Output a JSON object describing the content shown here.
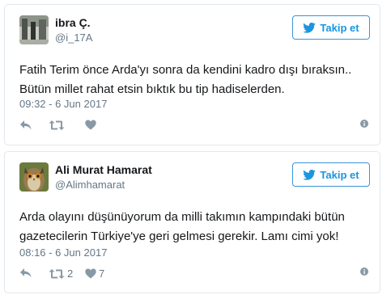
{
  "tweets": [
    {
      "name": "ibra Ç.",
      "handle": "@i_17A",
      "follow_label": "Takip et",
      "text": "Fatih Terim önce Arda'yı sonra da kendini kadro dışı bıraksın.. Bütün millet rahat etsin bıktık bu tip hadiselerden.",
      "time": "09:32 - 6 Jun 2017",
      "retweet_count": "",
      "like_count": ""
    },
    {
      "name": "Ali Murat Hamarat",
      "handle": "@Alimhamarat",
      "follow_label": "Takip et",
      "text": "Arda olayını düşünüyorum da milli takımın kampındaki bütün gazetecilerin Türkiye'ye geri gelmesi gerekir. Lamı cimi yok!",
      "time": "08:16 - 6 Jun 2017",
      "retweet_count": "2",
      "like_count": "7"
    }
  ],
  "colors": {
    "twitter_blue": "#1b95e0",
    "icon_gray": "#8899a6",
    "meta_gray": "#657786",
    "border": "#e1e8ed"
  },
  "icons": [
    "twitter-bird-icon",
    "reply-icon",
    "retweet-icon",
    "heart-icon",
    "info-icon"
  ]
}
